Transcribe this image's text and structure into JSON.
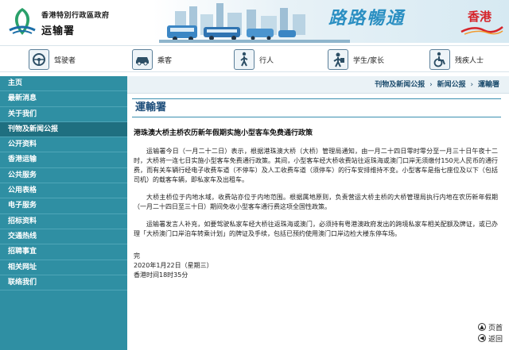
{
  "header": {
    "gov_name": "香港特別行政區政府",
    "dept_name": "运输署",
    "slogan": "路路暢通",
    "brand": "香港"
  },
  "audience_nav": [
    {
      "label": "驾驶者",
      "icon": "steering-wheel-icon"
    },
    {
      "label": "乘客",
      "icon": "car-icon"
    },
    {
      "label": "行人",
      "icon": "pedestrian-icon"
    },
    {
      "label": "学生/家长",
      "icon": "student-icon"
    },
    {
      "label": "残疾人士",
      "icon": "wheelchair-icon"
    }
  ],
  "sidebar": {
    "items": [
      {
        "label": "主页"
      },
      {
        "label": "最新消息"
      },
      {
        "label": "关于我们"
      },
      {
        "label": "刊物及新闻公报",
        "active": true
      },
      {
        "label": "公开资料"
      },
      {
        "label": "香港运输"
      },
      {
        "label": "公共服务"
      },
      {
        "label": "公用表格"
      },
      {
        "label": "电子服务"
      },
      {
        "label": "招标资料"
      },
      {
        "label": "交通热线"
      },
      {
        "label": "招聘事宜"
      },
      {
        "label": "相关网址"
      },
      {
        "label": "联络我们"
      }
    ]
  },
  "breadcrumb": {
    "items": [
      "刊物及新闻公报",
      "新闻公报"
    ],
    "current": "運輸署",
    "separator": "›"
  },
  "article": {
    "page_title": "運輸署",
    "headline": "港珠澳大桥主桥农历新年假期实施小型客车免费通行政策",
    "paragraphs": [
      "运输署今日（一月二十二日）表示，根据港珠澳大桥（大桥）管理局通知，由一月二十四日零时零分至一月三十日午夜十二时，大桥将一连七日实施小型客车免费通行政策。其间，小型客车经大桥收费站往返珠海或澳门口岸无须缴付150元人民币的通行费，而有关车辆行经电子收费车道（不停车）及人工收费车道（须停车）的行车安排维持不变。小型客车是指七座位及以下（包括司机）的载客车辆，即私家车及出租车。",
      "大桥主桥位于内地水域，收费站亦位于内地范围。根据属地原则，负责营运大桥主桥的大桥管理局执行内地在农历新年假期（一月二十四日至三十日）期间免收小型客车通行费这项全国性政策。",
      "运输署发言人补充，如要驾驶私家车经大桥往返珠海或澳门，必须持有粤港澳政府发出的跨境私家车相关配额及牌证，或已办理「大桥澳门口岸泊车转乘计划」的牌证及手续，包括已预约使用澳门口岸边检大楼东停车场。"
    ],
    "signoff_end": "完",
    "date": "2020年1月22日（星期三）",
    "time": "香港时间18时35分"
  },
  "footer": {
    "top_link": "页首",
    "back_link": "返回"
  },
  "colors": {
    "sidebar_bg": "#2f8fa3",
    "sidebar_active": "#1f6f80",
    "title_blue": "#1d4d7a",
    "brand_red": "#d6242a",
    "slogan_blue": "#2b8fc2"
  }
}
